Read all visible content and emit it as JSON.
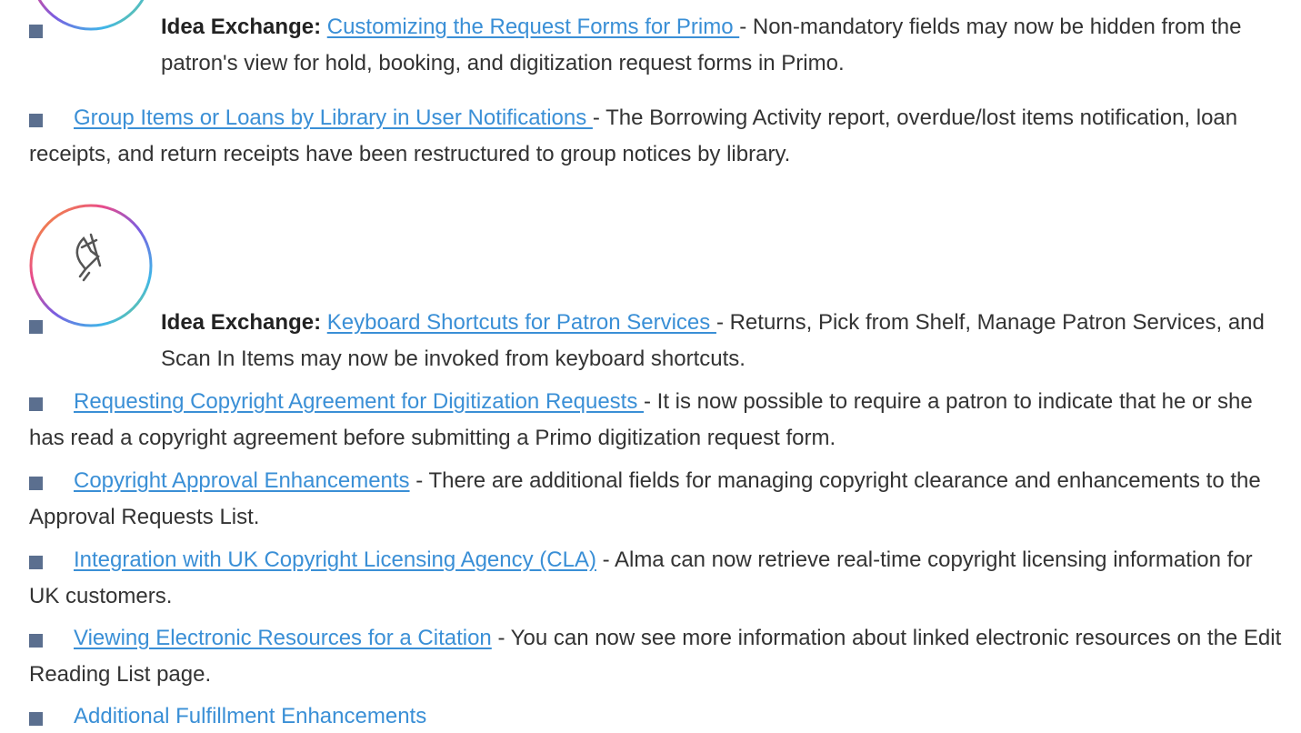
{
  "items": [
    {
      "label": "Idea Exchange:",
      "link": "Customizing the Request Forms for Primo ",
      "desc": "- Non-mandatory fields may now be hidden from the patron's view for hold, booking, and digitization request forms in Primo."
    },
    {
      "link": "Group Items or Loans by Library in User Notifications ",
      "desc": "- The Borrowing Activity report, overdue/lost items notification, loan receipts, and return receipts have been restructured to group notices by library."
    },
    {
      "label": "Idea Exchange:",
      "link": "Keyboard Shortcuts for Patron Services ",
      "desc": "- Returns, Pick from Shelf, Manage Patron Services, and Scan In Items may now be invoked from keyboard shortcuts."
    },
    {
      "link": "Requesting Copyright Agreement for Digitization Requests ",
      "desc": "- It is now possible to require a patron to indicate that he or she has read a copyright agreement before submitting a Primo digitization request form."
    },
    {
      "link": "Copyright Approval Enhancements",
      "desc": " - There are additional fields for managing copyright clearance and enhancements to the Approval Requests List."
    },
    {
      "link": "Integration with UK Copyright Licensing Agency (CLA)",
      "desc": " - Alma can now retrieve real-time copyright licensing information for UK customers."
    },
    {
      "link": "Viewing Electronic Resources for a Citation",
      "desc": " - You can now see more information about linked electronic resources on the Edit Reading List page."
    },
    {
      "link": "Additional Fulfillment Enhancements"
    }
  ],
  "colors": {
    "link": "#3a8fd6",
    "bullet": "#5b6f8f",
    "text": "#333333"
  }
}
